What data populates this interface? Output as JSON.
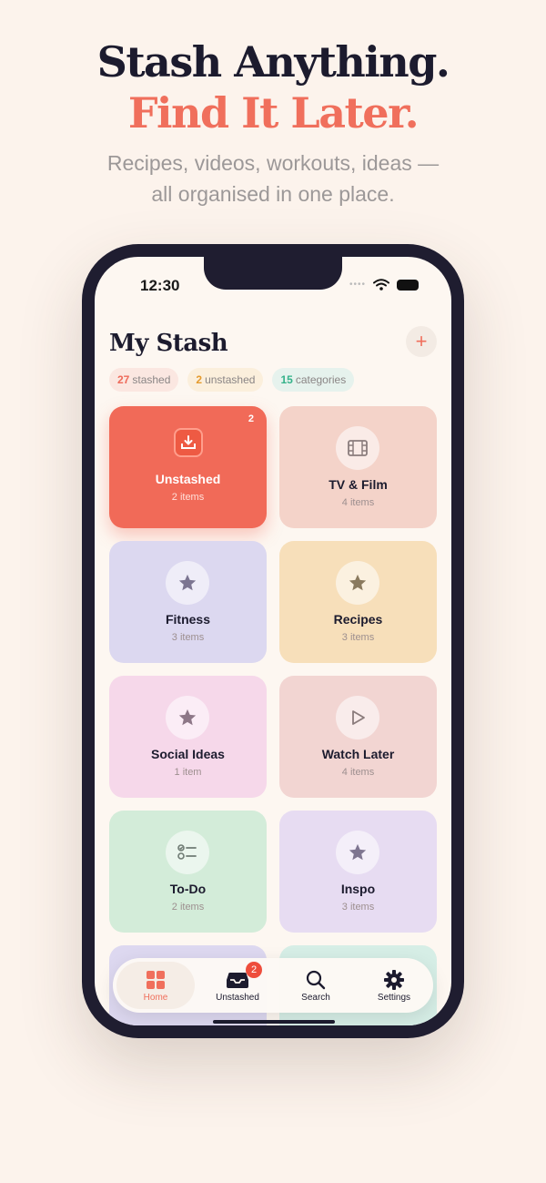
{
  "hero": {
    "line1": "Stash Anything.",
    "line2": "Find It Later.",
    "subtitle_line1": "Recipes, videos, workouts, ideas —",
    "subtitle_line2": "all organised in one place."
  },
  "status": {
    "time": "12:30"
  },
  "header": {
    "title": "My Stash",
    "add_label": "+"
  },
  "chips": [
    {
      "count": "27",
      "label": "stashed"
    },
    {
      "count": "2",
      "label": "unstashed"
    },
    {
      "count": "15",
      "label": "categories"
    }
  ],
  "cards": [
    {
      "name": "Unstashed",
      "count": "2 items",
      "badge": "2",
      "icon": "inbox-icon",
      "color": "#f16a58"
    },
    {
      "name": "TV & Film",
      "count": "4 items",
      "icon": "film-icon",
      "color": "#f4d3c9"
    },
    {
      "name": "Fitness",
      "count": "3 items",
      "icon": "star-icon",
      "color": "#dcd8f0"
    },
    {
      "name": "Recipes",
      "count": "3 items",
      "icon": "star-icon",
      "color": "#f7dfba"
    },
    {
      "name": "Social Ideas",
      "count": "1 item",
      "icon": "star-icon",
      "color": "#f6d8ea"
    },
    {
      "name": "Watch Later",
      "count": "4 items",
      "icon": "play-icon",
      "color": "#f2d5d2"
    },
    {
      "name": "To-Do",
      "count": "2 items",
      "icon": "checklist-icon",
      "color": "#d3ecd9"
    },
    {
      "name": "Inspo",
      "count": "3 items",
      "icon": "star-icon",
      "color": "#e7dcf2"
    }
  ],
  "nav": [
    {
      "label": "Home",
      "icon": "grid-icon"
    },
    {
      "label": "Unstashed",
      "icon": "inbox-icon",
      "badge": "2"
    },
    {
      "label": "Search",
      "icon": "search-icon"
    },
    {
      "label": "Settings",
      "icon": "gear-icon"
    }
  ]
}
